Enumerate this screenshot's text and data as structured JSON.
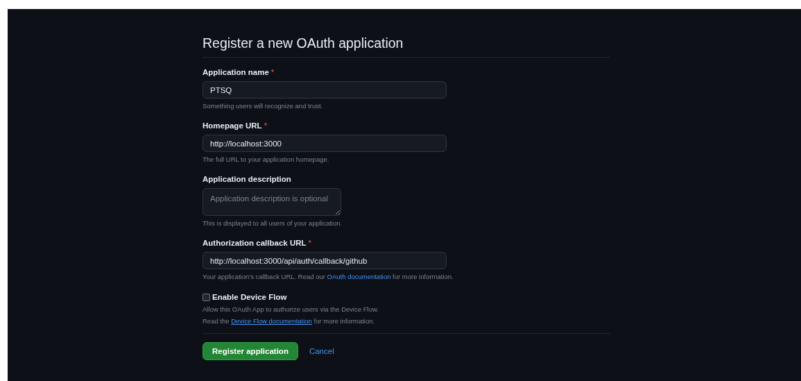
{
  "title": "Register a new OAuth application",
  "fields": [
    {
      "kind": "input",
      "label": "Application name",
      "required_mark": "*",
      "value": "PTSQ",
      "hint": {
        "text": "Something users will recognize and trust."
      }
    },
    {
      "kind": "input",
      "label": "Homepage URL",
      "required_mark": "*",
      "value": "http://localhost:3000",
      "hint": {
        "text": "The full URL to your application homepage."
      }
    },
    {
      "kind": "textarea",
      "label": "Application description",
      "placeholder": "Application description is optional",
      "hint": {
        "text": "This is displayed to all users of your application."
      }
    },
    {
      "kind": "input",
      "label": "Authorization callback URL",
      "required_mark": "*",
      "value": "http://localhost:3000/api/auth/callback/github",
      "hint": {
        "text": "Your application’s callback URL. Read our",
        "link": "OAuth documentation",
        "after": "for more information.",
        "underline": false
      }
    }
  ],
  "device_flow": {
    "label": "Enable Device Flow",
    "checked": false,
    "notes": [
      {
        "text": "Allow this OAuth App to authorize users via the Device Flow."
      },
      {
        "text": "Read the",
        "link": "Device Flow documentation",
        "after": "for more information.",
        "underline": true
      }
    ]
  },
  "buttons": {
    "submit": "Register application",
    "cancel": "Cancel"
  }
}
